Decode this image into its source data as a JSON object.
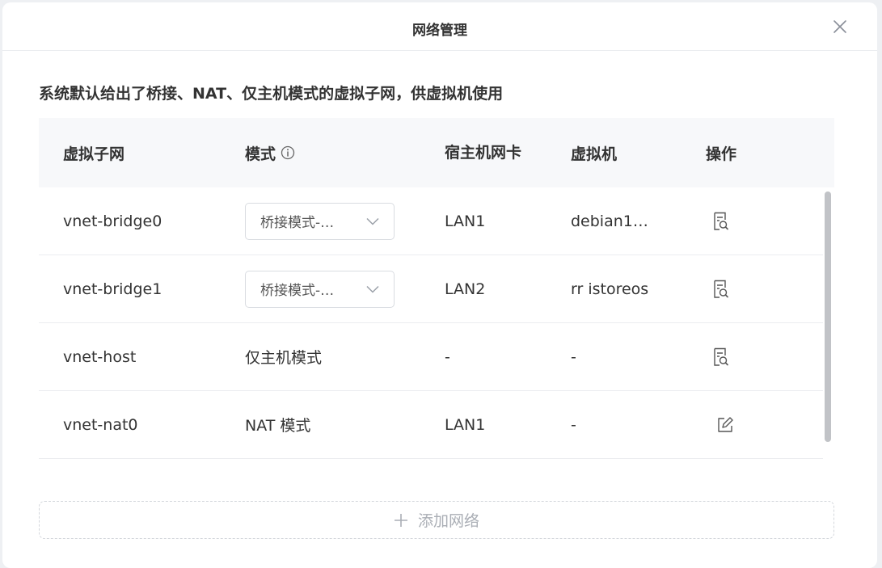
{
  "dialog": {
    "title": "网络管理",
    "description": "系统默认给出了桥接、NAT、仅主机模式的虚拟子网，供虚拟机使用"
  },
  "table": {
    "headers": {
      "subnet": "虚拟子网",
      "mode": "模式",
      "host_nic": "宿主机网卡",
      "vm": "虚拟机",
      "actions": "操作"
    },
    "rows": [
      {
        "subnet": "vnet-bridge0",
        "mode": "桥接模式-…",
        "mode_is_select": true,
        "host_nic": "LAN1",
        "vm": "debian1…",
        "action_icon": "view-details-icon"
      },
      {
        "subnet": "vnet-bridge1",
        "mode": "桥接模式-…",
        "mode_is_select": true,
        "host_nic": "LAN2",
        "vm": "rr istoreos",
        "action_icon": "view-details-icon"
      },
      {
        "subnet": "vnet-host",
        "mode": "仅主机模式",
        "mode_is_select": false,
        "host_nic": "-",
        "vm": "-",
        "action_icon": "view-details-icon"
      },
      {
        "subnet": "vnet-nat0",
        "mode": "NAT 模式",
        "mode_is_select": false,
        "host_nic": "LAN1",
        "vm": "-",
        "action_icon": "edit-icon"
      }
    ]
  },
  "add_button": {
    "label": "添加网络"
  },
  "colors": {
    "text": "#333333",
    "header_bg": "#f7f8fa",
    "border": "#ebedf0",
    "muted": "#aaaeb5"
  }
}
